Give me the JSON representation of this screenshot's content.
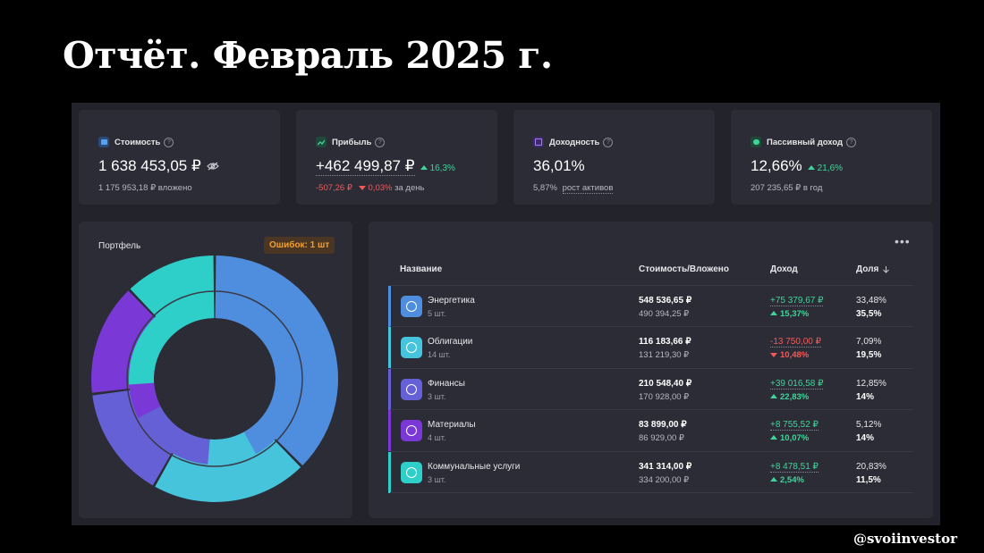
{
  "slide_title": "Отчёт. Февраль 2025 г.",
  "watermark": "@svoiinvestor",
  "colors": {
    "page_bg": "#000000",
    "app_bg": "#23232c",
    "card_bg": "#2c2c37",
    "up": "#3fd49a",
    "down": "#ef5b5b",
    "warning": "#f0a030"
  },
  "stats": {
    "cost": {
      "label": "Стоимость",
      "value": "1 638 453,05 ₽",
      "invested": "1 175 953,18 ₽ вложено",
      "icon": "wallet-icon"
    },
    "profit": {
      "label": "Прибыль",
      "value": "+462 499,87 ₽",
      "delta": "16,3%",
      "day_value": "-507,26 ₽",
      "day_pct": "0,03%",
      "day_suffix": "за день",
      "icon": "chart-icon"
    },
    "yield": {
      "label": "Доходность",
      "value": "36,01%",
      "growth_value": "5,87%",
      "growth_label": "рост активов",
      "icon": "calendar-icon"
    },
    "passive": {
      "label": "Пассивный доход",
      "value": "12,66%",
      "delta": "21,6%",
      "sub": "207 235,65 ₽ в год",
      "icon": "piggy-bank-icon"
    }
  },
  "portfolio": {
    "label": "Портфель",
    "errors_badge": "Ошибок: 1 шт"
  },
  "table": {
    "headers": {
      "name": "Название",
      "cost": "Стоимость/Вложено",
      "income": "Доход",
      "share": "Доля"
    },
    "rows": [
      {
        "name": "Энергетика",
        "count": "5 шт.",
        "cost": "548 536,65 ₽",
        "invested": "490 394,25 ₽",
        "income": "+75 379,67 ₽",
        "income_pct": "15,37%",
        "direction": "up",
        "share": "33,48%",
        "target": "35,5%",
        "color": "#4f8ede"
      },
      {
        "name": "Облигации",
        "count": "14 шт.",
        "cost": "116 183,66 ₽",
        "invested": "131 219,30 ₽",
        "income": "-13 750,00 ₽",
        "income_pct": "10,48%",
        "direction": "down",
        "share": "7,09%",
        "target": "19,5%",
        "color": "#45c4dc"
      },
      {
        "name": "Финансы",
        "count": "3 шт.",
        "cost": "210 548,40 ₽",
        "invested": "170 928,00 ₽",
        "income": "+39 016,58 ₽",
        "income_pct": "22,83%",
        "direction": "up",
        "share": "12,85%",
        "target": "14%",
        "color": "#6560d6"
      },
      {
        "name": "Материалы",
        "count": "4 шт.",
        "cost": "83 899,00 ₽",
        "invested": "86 929,00 ₽",
        "income": "+8 755,52 ₽",
        "income_pct": "10,07%",
        "direction": "up",
        "share": "5,12%",
        "target": "14%",
        "color": "#7a38d6"
      },
      {
        "name": "Коммунальные услуги",
        "count": "3 шт.",
        "cost": "341 314,00 ₽",
        "invested": "334 200,00 ₽",
        "income": "+8 478,51 ₽",
        "income_pct": "2,54%",
        "direction": "up",
        "share": "20,83%",
        "target": "11,5%",
        "color": "#2ecfc9"
      }
    ]
  },
  "chart_data": {
    "type": "pie",
    "categories": [
      "Энергетика",
      "Облигации",
      "Финансы",
      "Материалы",
      "Коммунальные услуги"
    ],
    "series": [
      {
        "values": [
          33.48,
          7.09,
          12.85,
          5.12,
          20.83
        ]
      },
      {
        "values": [
          35.5,
          19.5,
          14,
          14,
          11.5
        ]
      }
    ],
    "colors": [
      "#4f8ede",
      "#45c4dc",
      "#6560d6",
      "#7a38d6",
      "#2ecfc9"
    ],
    "style": "donut"
  }
}
